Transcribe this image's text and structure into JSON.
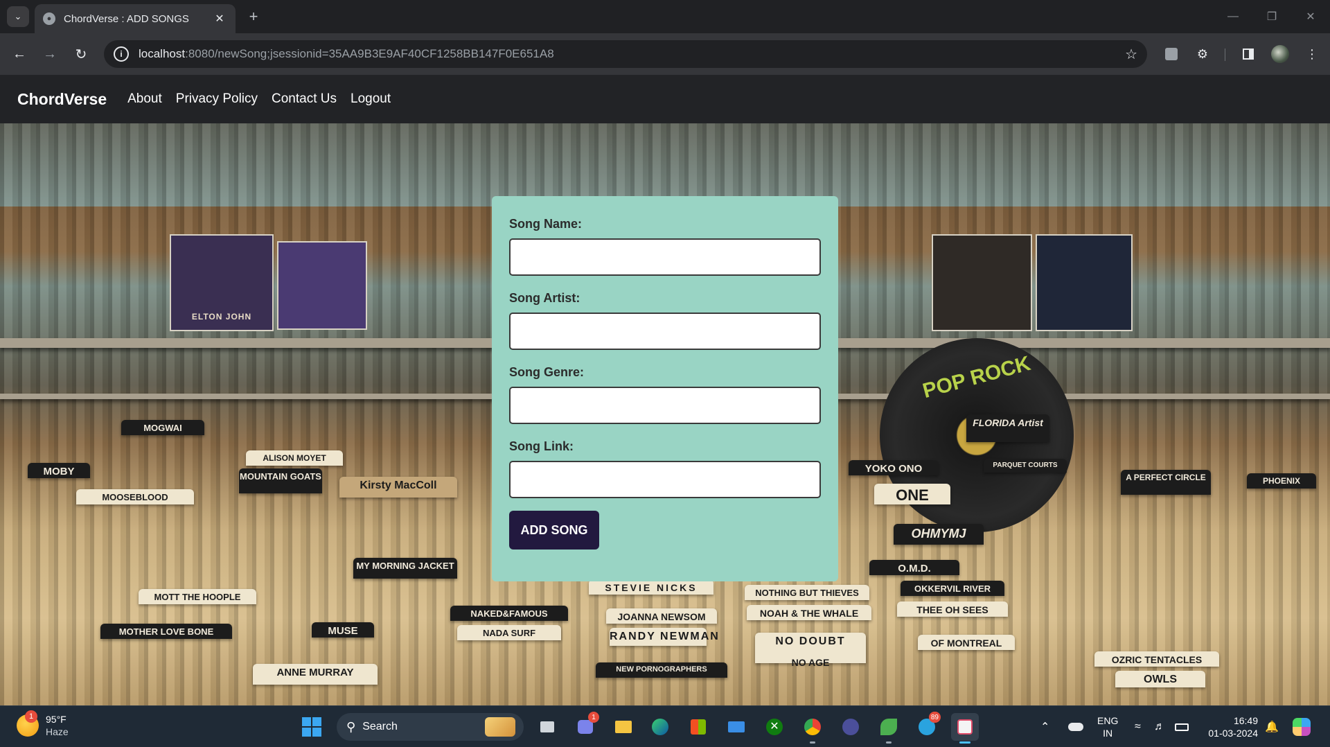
{
  "browser": {
    "tab_title": "ChordVerse : ADD SONGS",
    "url_host": "localhost",
    "url_path": ":8080/newSong;jsessionid=35AA9B3E9AF40CF1258BB147F0E651A8"
  },
  "site": {
    "brand": "ChordVerse",
    "nav": {
      "about": "About",
      "privacy": "Privacy Policy",
      "contact": "Contact Us",
      "logout": "Logout"
    }
  },
  "form": {
    "song_name_label": "Song Name:",
    "song_name_value": "",
    "song_artist_label": "Song Artist:",
    "song_artist_value": "",
    "song_genre_label": "Song Genre:",
    "song_genre_value": "",
    "song_link_label": "Song Link:",
    "song_link_value": "",
    "submit_label": "ADD SONG"
  },
  "background_cards": {
    "c1": "ELTON JOHN",
    "c2": "MOGWAI",
    "c3": "MOUNTAIN GOATS",
    "c4": "Kirsty MacColl",
    "c5": "MOOSEBLOOD",
    "c6": "MOBY",
    "c7": "ALISON MOYET",
    "c8": "MY MORNING JACKET",
    "c9": "MOTT THE HOOPLE",
    "c10": "MUSE",
    "c11": "ANNE MURRAY",
    "c12": "MOTHER LOVE BONE",
    "c13": "NAKED&FAMOUS",
    "c14": "NADA SURF",
    "c15": "STEVIE NICKS",
    "c16": "JOANNA NEWSOM",
    "c17": "RANDY NEWMAN",
    "c18": "NEW PORNOGRAPHERS",
    "c19": "NOTHING BUT THIEVES",
    "c20": "NOAH & THE WHALE",
    "c21": "NO DOUBT",
    "c22": "NO AGE",
    "c23": "YOKO ONO",
    "c24": "ONE",
    "c25": "OHMYMJ",
    "c26": "O.M.D.",
    "c27": "OKKERVIL RIVER",
    "c28": "THEE OH SEES",
    "c29": "OF MONTREAL",
    "c30": "OZRIC TENTACLES",
    "c31": "OWLS",
    "c32": "A PERFECT CIRCLE",
    "c33": "PHOENIX",
    "c34": "PARQUET COURTS",
    "c35": "FLORIDA Artist",
    "c36": "POP ROCK"
  },
  "taskbar": {
    "weather_temp": "95°F",
    "weather_cond": "Haze",
    "weather_badge": "1",
    "search_label": "Search",
    "teams_badge": "1",
    "telegram_badge": "89",
    "lang_top": "ENG",
    "lang_bottom": "IN",
    "time": "16:49",
    "date": "01-03-2024"
  }
}
